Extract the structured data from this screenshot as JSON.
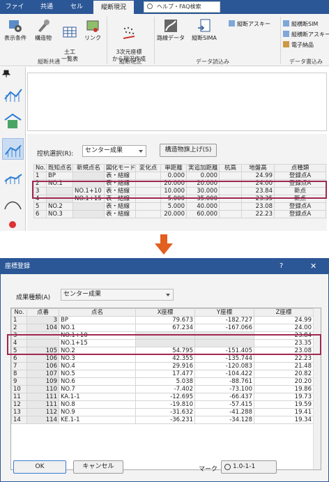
{
  "tabs": [
    "ファイル",
    "共通",
    "セル",
    "縦断現況"
  ],
  "search_placeholder": "ヘルプ・FAQ検索",
  "ribbon": {
    "buttons": [
      "表示条件",
      "構造物",
      "土工\n一覧表",
      "リンク",
      "3次元座標\nから現況作成",
      "路線データ",
      "縦断SIMA"
    ],
    "small": [
      "縦断アスキー",
      "縦横断SIM",
      "縦横断アスキー",
      "電子納品"
    ],
    "groups": [
      "縦断共通",
      "縦断現況",
      "データ読込み",
      "データ書込み"
    ]
  },
  "pane": {
    "select_label": "控杭選択(R):",
    "select_value": "センター成果",
    "button": "構造物旗上げ(S)",
    "headers": [
      "No.",
      "既知点名",
      "新規点名",
      "図化モード",
      "変化点",
      "単距離",
      "実追加距離",
      "杭高",
      "地盤高",
      "点種類"
    ],
    "rows": [
      [
        "1",
        "BP",
        "",
        "表・結線",
        "",
        "0.000",
        "0.000",
        "",
        "24.99",
        "登録点A"
      ],
      [
        "2",
        "NO.1",
        "",
        "表・結線",
        "",
        "20.000",
        "20.000",
        "",
        "24.00",
        "登録点A"
      ],
      [
        "3",
        "",
        "NO.1+10",
        "表・結線",
        "",
        "10.000",
        "30.000",
        "",
        "23.84",
        "新点"
      ],
      [
        "4",
        "",
        "NO.1+15",
        "表・結線",
        "",
        "5.000",
        "35.000",
        "",
        "23.35",
        "新点"
      ],
      [
        "5",
        "NO.2",
        "",
        "表・結線",
        "",
        "5.000",
        "40.000",
        "",
        "23.08",
        "登録点A"
      ],
      [
        "6",
        "NO.3",
        "",
        "表・結線",
        "",
        "20.000",
        "60.000",
        "",
        "22.23",
        "登録点A"
      ]
    ]
  },
  "dialog": {
    "title": "座標登録",
    "help": "?",
    "close": "✕",
    "type_label": "成果種類(A)",
    "type_value": "センター成果",
    "headers": [
      "No.",
      "点番",
      "点名",
      "X座標",
      "Y座標",
      "Z座標"
    ],
    "rows": [
      [
        "1",
        "3",
        "BP",
        "79.673",
        "-182.727",
        "24.99"
      ],
      [
        "2",
        "104",
        "NO.1",
        "67.234",
        "-167.066",
        "24.00"
      ],
      [
        "3",
        "",
        "NO.1+10",
        "",
        "",
        "23.84"
      ],
      [
        "4",
        "",
        "NO.1+15",
        "",
        "",
        "23.35"
      ],
      [
        "5",
        "105",
        "NO.2",
        "54.795",
        "-151.405",
        "23.08"
      ],
      [
        "6",
        "106",
        "NO.3",
        "42.355",
        "-135.744",
        "22.23"
      ],
      [
        "7",
        "106",
        "NO.4",
        "29.916",
        "-120.083",
        "21.48"
      ],
      [
        "8",
        "107",
        "NO.5",
        "17.477",
        "-104.422",
        "20.82"
      ],
      [
        "9",
        "109",
        "NO.6",
        "5.038",
        "-88.761",
        "20.20"
      ],
      [
        "10",
        "110",
        "NO.7",
        "-7.402",
        "-73.100",
        "19.86"
      ],
      [
        "11",
        "111",
        "KA.1-1",
        "-12.695",
        "-66.437",
        "19.73"
      ],
      [
        "12",
        "111",
        "NO.8",
        "-19.810",
        "-57.415",
        "19.59"
      ],
      [
        "13",
        "112",
        "NO.9",
        "-31.632",
        "-41.288",
        "19.41"
      ],
      [
        "14",
        "114",
        "KE.1-1",
        "-36.231",
        "-34.128",
        "19.34"
      ]
    ],
    "ok": "OK",
    "cancel": "キャンセル",
    "mark_label": "マーク",
    "mark_value": "1.0-1-1"
  }
}
